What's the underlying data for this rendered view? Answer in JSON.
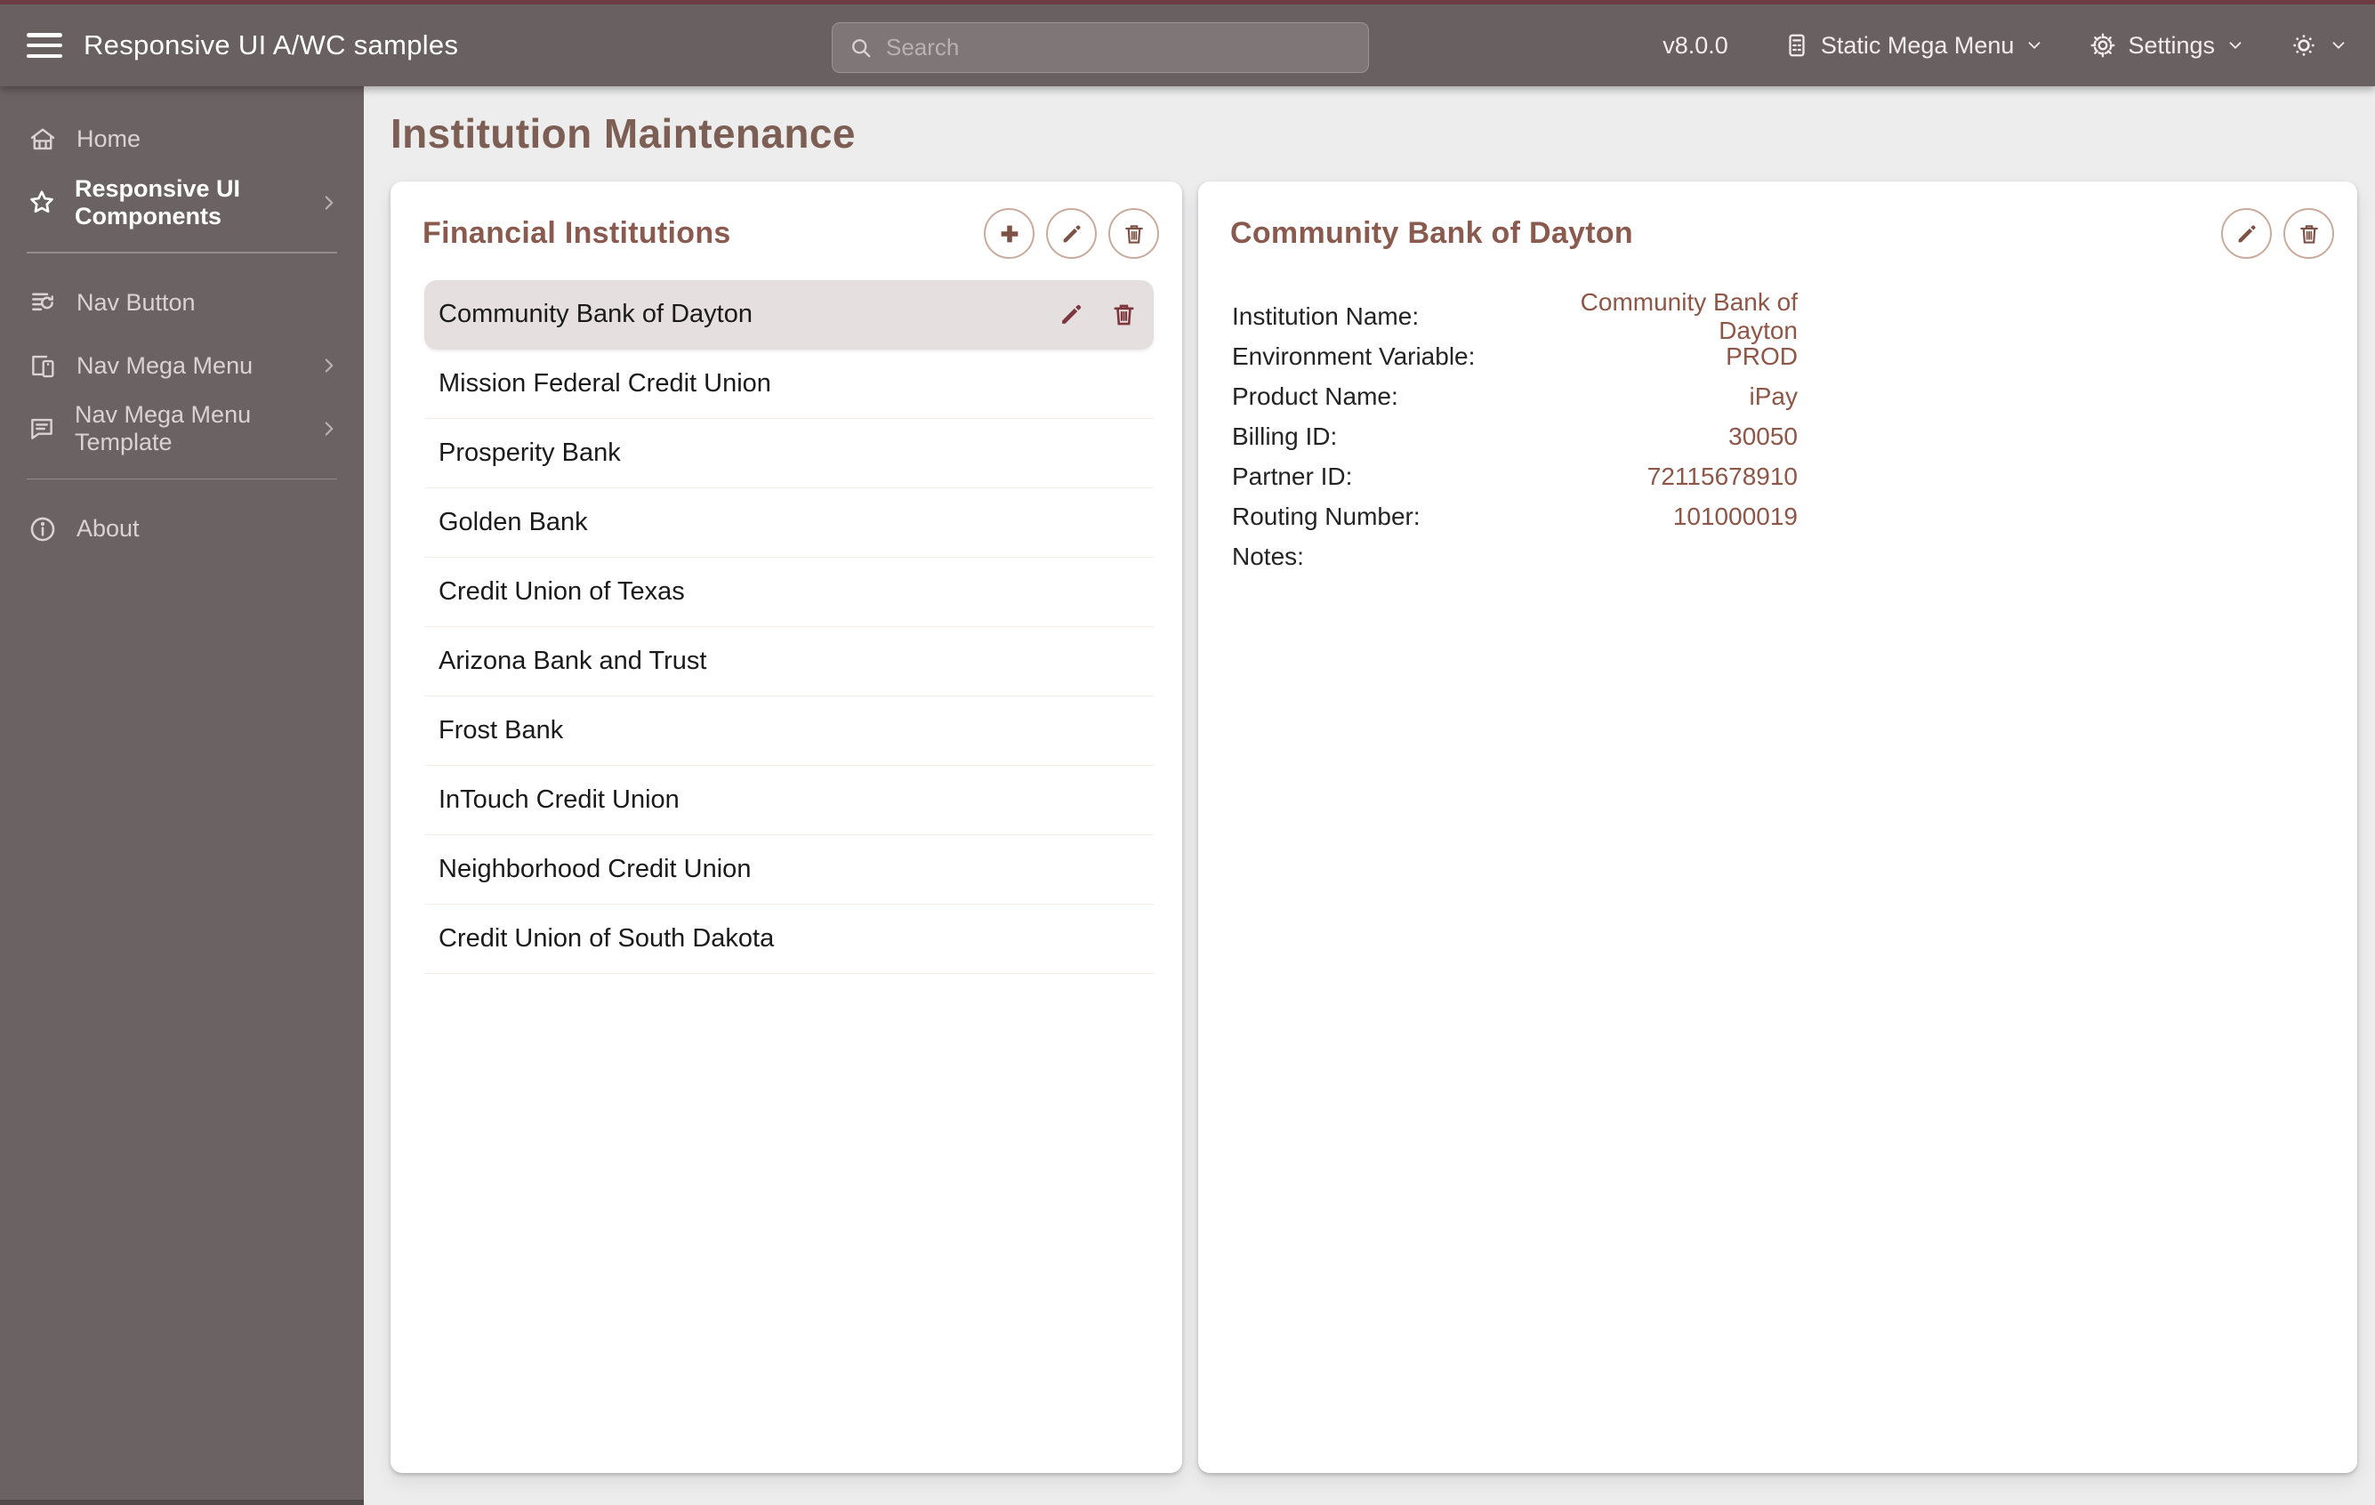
{
  "header": {
    "app_title": "Responsive UI A/WC samples",
    "search_placeholder": "Search",
    "version": "v8.0.0",
    "mega_menu_label": "Static Mega Menu",
    "settings_label": "Settings",
    "icons": [
      "hamburger-icon",
      "search-icon",
      "mega-menu-icon",
      "gear-icon",
      "sun-icon",
      "chevron-down-icon"
    ]
  },
  "sidebar": {
    "items": [
      {
        "label": "Home",
        "icon": "home-icon",
        "chevron": false,
        "active": false
      },
      {
        "label": "Responsive UI Components",
        "icon": "star-icon",
        "chevron": true,
        "active": true
      },
      {
        "label": "Nav Button",
        "icon": "nav-button-icon",
        "chevron": false,
        "active": false
      },
      {
        "label": "Nav Mega Menu",
        "icon": "nav-mega-menu-icon",
        "chevron": true,
        "active": false
      },
      {
        "label": "Nav Mega Menu Template",
        "icon": "nav-mega-menu-template-icon",
        "chevron": true,
        "active": false
      },
      {
        "label": "About",
        "icon": "info-icon",
        "chevron": false,
        "active": false
      }
    ]
  },
  "page": {
    "title": "Institution Maintenance"
  },
  "list_card": {
    "title": "Financial Institutions",
    "actions": [
      "add",
      "edit",
      "delete"
    ],
    "selected_index": 0,
    "items": [
      "Community Bank of Dayton",
      "Mission Federal Credit Union",
      "Prosperity Bank",
      "Golden Bank",
      "Credit Union of Texas",
      "Arizona Bank and Trust",
      "Frost Bank",
      "InTouch Credit Union",
      "Neighborhood Credit Union",
      "Credit Union of South Dakota"
    ]
  },
  "detail_card": {
    "title": "Community Bank of Dayton",
    "actions": [
      "edit",
      "delete"
    ],
    "fields": [
      {
        "label": "Institution Name:",
        "value": "Community Bank of Dayton"
      },
      {
        "label": "Environment Variable:",
        "value": "PROD"
      },
      {
        "label": "Product Name:",
        "value": "iPay"
      },
      {
        "label": "Billing ID:",
        "value": "30050"
      },
      {
        "label": "Partner ID:",
        "value": "72115678910"
      },
      {
        "label": "Routing Number:",
        "value": "101000019"
      },
      {
        "label": "Notes:",
        "value": ""
      }
    ]
  },
  "colors": {
    "top_accent_strip": "#6e3a43",
    "header_bg": "#696061",
    "sidebar_bg": "#6b6263",
    "main_bg": "#ededee",
    "card_bg": "#ffffff",
    "heading_brown": "#7c5e54",
    "card_title_brown": "#8a5a4e",
    "value_brown": "#8d5647",
    "selected_row_bg": "#e6dfdf",
    "row_action_maroon": "#7c363c",
    "circle_button_border": "#c9ab9e",
    "circle_button_icon": "#7d5244"
  }
}
